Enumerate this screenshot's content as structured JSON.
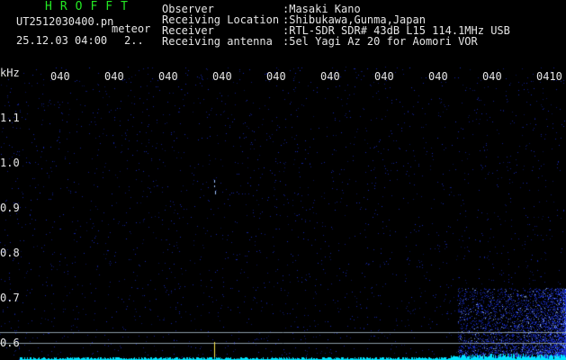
{
  "app": {
    "title": "HROFFT"
  },
  "file": {
    "name": "UT2512030400.pn",
    "tag": "meteor",
    "datetime": "25.12.03 04:00",
    "count": "2.."
  },
  "station": [
    {
      "label": "Observer",
      "value": ":Masaki Kano"
    },
    {
      "label": "Receiving Location",
      "value": ":Shibukawa,Gunma,Japan"
    },
    {
      "label": "Receiver",
      "value": ":RTL-SDR SDR# 43dB L15 114.1MHz USB"
    },
    {
      "label": "Receiving antenna",
      "value": ":5el Yagi Az 20 for Aomori VOR"
    }
  ],
  "xaxis": {
    "ticks": [
      "040",
      "040",
      "040",
      "040",
      "040",
      "040",
      "040",
      "040",
      "040",
      "0410"
    ]
  },
  "yaxis": {
    "unit": "kHz",
    "ticks": [
      "1.1",
      "1.0",
      "0.9",
      "0.8",
      "0.7",
      "0.6"
    ]
  },
  "colors": {
    "background": "#000000",
    "noise": "#1a2fd6",
    "text": "#e6e6e6",
    "title": "#23e823",
    "trace": "#00e5ff",
    "echo": "#9fc2ff"
  }
}
